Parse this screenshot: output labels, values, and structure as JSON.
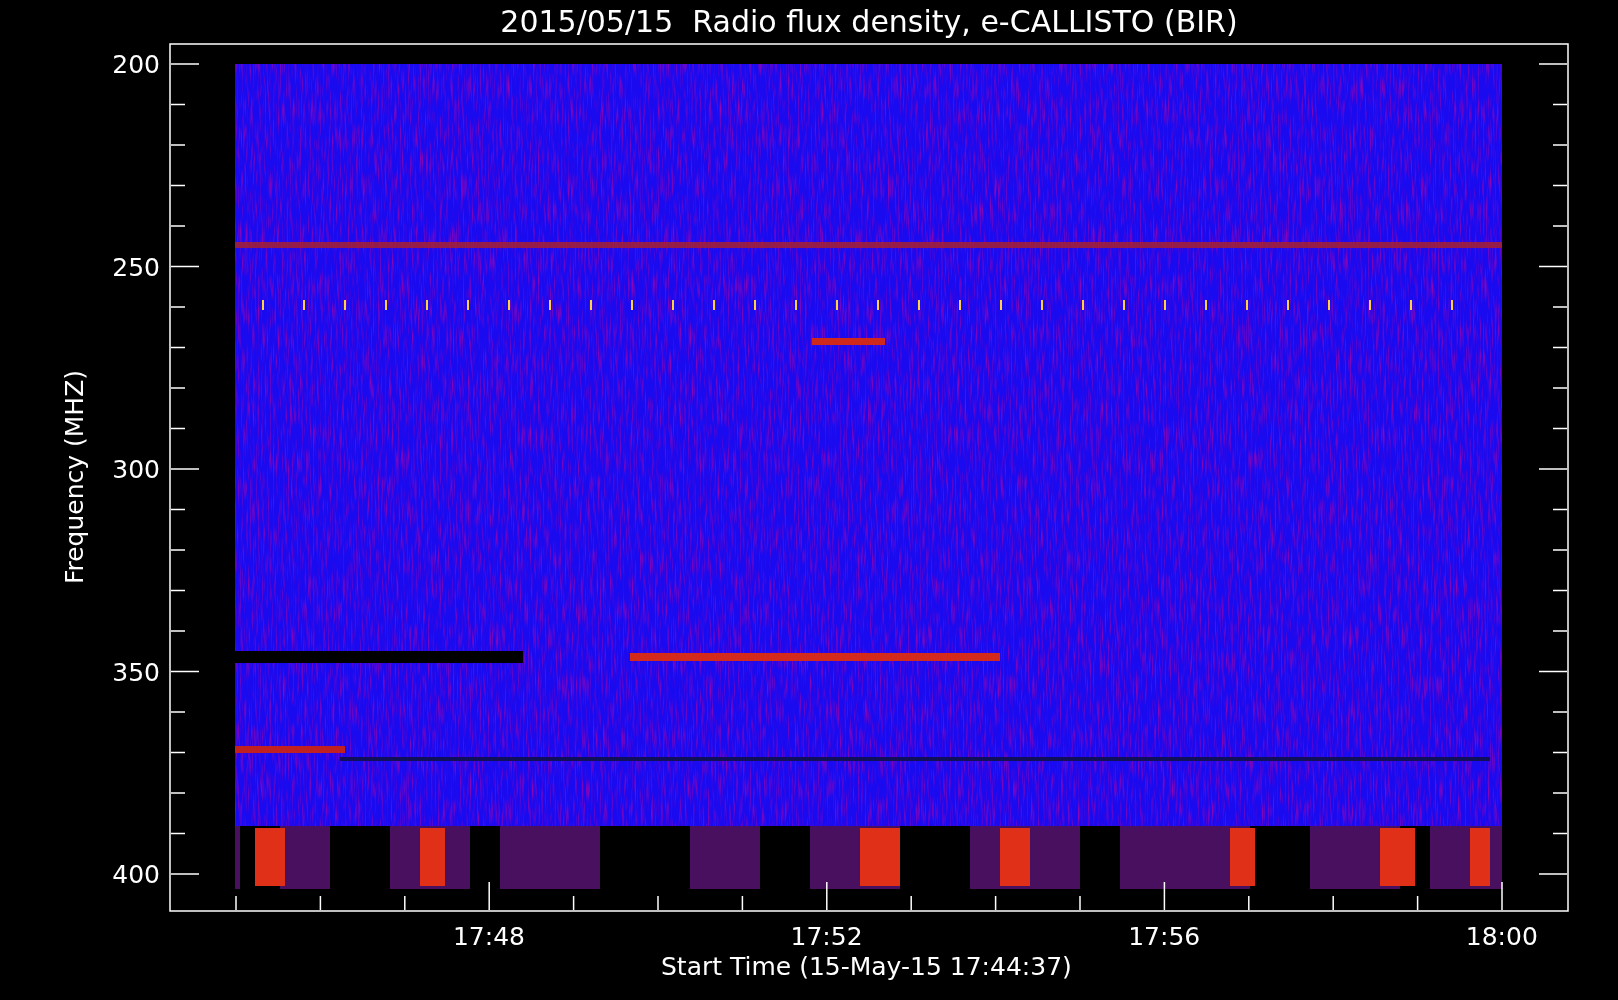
{
  "plot": {
    "title": "2015/05/15  Radio flux density, e-CALLISTO (BIR)",
    "xlabel": "Start Time (15-May-15 17:44:37)",
    "ylabel": "Frequency (MHZ)",
    "xtick_labels": [
      "17:48",
      "17:52",
      "17:56",
      "18:00"
    ],
    "ytick_labels": [
      "200",
      "250",
      "300",
      "350",
      "400"
    ],
    "spectrogram": {
      "kind": "picture"
    }
  }
}
